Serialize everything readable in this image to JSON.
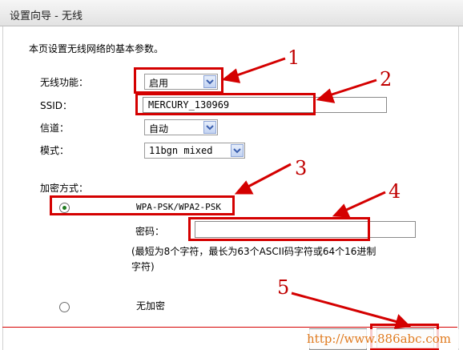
{
  "window": {
    "title": "设置向导 - 无线"
  },
  "intro": "本页设置无线网络的基本参数。",
  "fields": {
    "wireless_label": "无线功能：",
    "wireless_value": "启用",
    "ssid_label": "SSID：",
    "ssid_value": "MERCURY_130969",
    "channel_label": "信道：",
    "channel_value": "自动",
    "mode_label": "模式：",
    "mode_value": "11bgn mixed"
  },
  "security": {
    "label": "加密方式：",
    "wpa_option": "WPA-PSK/WPA2-PSK",
    "password_label": "密码：",
    "password_value": "",
    "hint_line1": "(最短为8个字符，最长为63个ASCII码字符或64个16进制",
    "hint_line2": "字符)",
    "none_option": "无加密"
  },
  "annotations": [
    "1",
    "2",
    "3",
    "4",
    "5"
  ],
  "watermark": "http://www.886abc.com",
  "colors": {
    "annotation_red": "#d40000",
    "selected_radio": "#1f7a1f",
    "watermark": "#e07a1e"
  }
}
